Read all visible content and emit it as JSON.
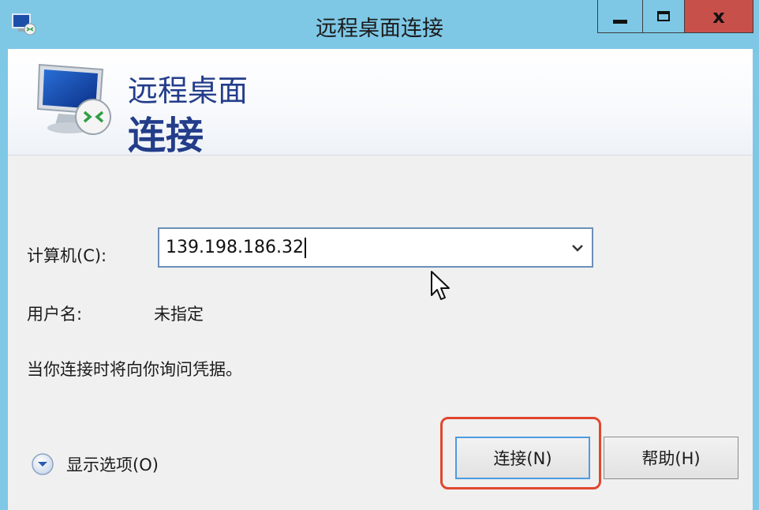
{
  "window": {
    "title": "远程桌面连接",
    "minimize_glyph": "",
    "close_glyph": "x"
  },
  "banner": {
    "line1": "远程桌面",
    "line2": "连接"
  },
  "form": {
    "computer_label": "计算机(C):",
    "computer_value": "139.198.186.32",
    "username_label": "用户名:",
    "username_value": "未指定",
    "credentials_note": "当你连接时将向你询问凭据。"
  },
  "footer": {
    "show_options_label": "显示选项(O)",
    "connect_label": "连接(N)",
    "help_label": "帮助(H)"
  },
  "colors": {
    "title_bg": "#7ec8e6",
    "close_bg": "#c7504a",
    "banner_text": "#233d8a",
    "highlight": "#e0472e"
  },
  "icons": [
    "rdp-icon",
    "monitor-icon",
    "dropdown-arrow-icon",
    "mouse-cursor-icon",
    "expand-options-icon"
  ]
}
